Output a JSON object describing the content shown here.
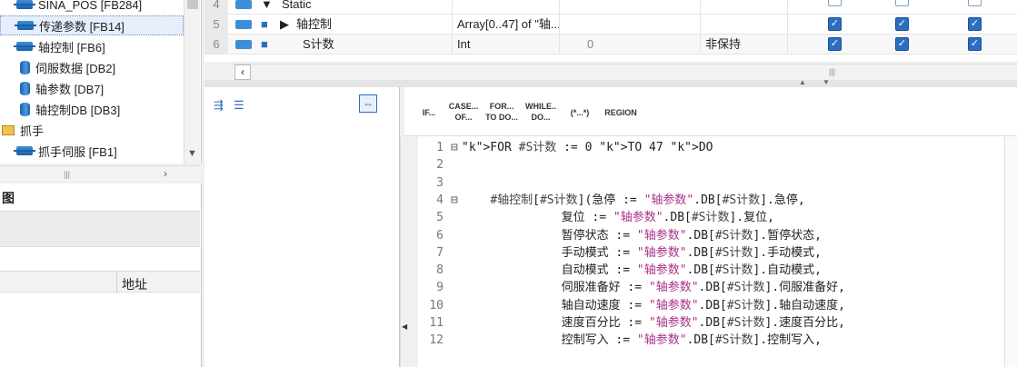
{
  "tree": {
    "items": [
      {
        "label": "SINA_POS [FB284]",
        "icon": "fb-icon"
      },
      {
        "label": "传递参数 [FB14]",
        "icon": "fb-icon"
      },
      {
        "label": "轴控制 [FB6]",
        "icon": "fb-icon"
      },
      {
        "label": "伺服数据 [DB2]",
        "icon": "db-icon"
      },
      {
        "label": "轴参数 [DB7]",
        "icon": "db-icon"
      },
      {
        "label": "轴控制DB [DB3]",
        "icon": "db-icon"
      },
      {
        "label": "抓手",
        "icon": "folder-icon"
      },
      {
        "label": "抓手伺服 [FB1]",
        "icon": "fb-icon"
      }
    ]
  },
  "lower_panel": {
    "title_fragment": "图",
    "address_header": "地址"
  },
  "interface": {
    "rows": [
      {
        "num": "4",
        "name": "Static",
        "type": "",
        "default": "",
        "retain": ""
      },
      {
        "num": "5",
        "name": "轴控制",
        "type": "Array[0..47] of \"轴...",
        "default": "",
        "retain": ""
      },
      {
        "num": "6",
        "name": "S计数",
        "type": "Int",
        "default": "0",
        "retain": "非保持"
      }
    ]
  },
  "keywords": [
    {
      "line1": "IF...",
      "line2": ""
    },
    {
      "line1": "CASE...",
      "line2": "OF..."
    },
    {
      "line1": "FOR...",
      "line2": "TO DO..."
    },
    {
      "line1": "WHILE..",
      "line2": "DO..."
    },
    {
      "line1": "(*...*)",
      "line2": ""
    },
    {
      "line1": "REGION",
      "line2": ""
    }
  ],
  "code": {
    "lines": [
      {
        "n": "1",
        "fold": "⊟",
        "text": "FOR #S计数 := 0 TO 47 DO"
      },
      {
        "n": "2",
        "fold": "",
        "text": ""
      },
      {
        "n": "3",
        "fold": "",
        "text": ""
      },
      {
        "n": "4",
        "fold": "⊟",
        "text": "    #轴控制[#S计数](急停 := \"轴参数\".DB[#S计数].急停,"
      },
      {
        "n": "5",
        "fold": "",
        "text": "              复位 := \"轴参数\".DB[#S计数].复位,"
      },
      {
        "n": "6",
        "fold": "",
        "text": "              暂停状态 := \"轴参数\".DB[#S计数].暂停状态,"
      },
      {
        "n": "7",
        "fold": "",
        "text": "              手动模式 := \"轴参数\".DB[#S计数].手动模式,"
      },
      {
        "n": "8",
        "fold": "",
        "text": "              自动模式 := \"轴参数\".DB[#S计数].自动模式,"
      },
      {
        "n": "9",
        "fold": "",
        "text": "              伺服准备好 := \"轴参数\".DB[#S计数].伺服准备好,"
      },
      {
        "n": "10",
        "fold": "",
        "text": "              轴自动速度 := \"轴参数\".DB[#S计数].轴自动速度,"
      },
      {
        "n": "11",
        "fold": "",
        "text": "              速度百分比 := \"轴参数\".DB[#S计数].速度百分比,"
      },
      {
        "n": "12",
        "fold": "",
        "text": "              控制写入 := \"轴参数\".DB[#S计数].控制写入,"
      }
    ]
  },
  "colors": {
    "accent": "#2c6fc2",
    "keyword": "#1d3fa8"
  }
}
